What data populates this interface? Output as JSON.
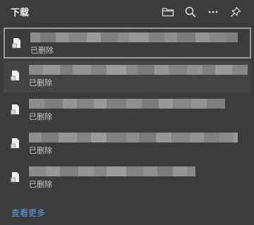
{
  "header": {
    "title": "下载",
    "icons": [
      "folder-icon",
      "search-icon",
      "more-options-icon",
      "pin-icon"
    ]
  },
  "downloads": [
    {
      "status": "已删除",
      "state": "selected"
    },
    {
      "status": "已删除",
      "state": "hover"
    },
    {
      "status": "已删除",
      "state": "normal"
    },
    {
      "status": "已删除",
      "state": "normal"
    },
    {
      "status": "已删除",
      "state": "normal"
    }
  ],
  "footer": {
    "see_more": "查看更多"
  },
  "colors": {
    "background": "#3c3c3c",
    "link": "#5aa0e6",
    "selected_border": "#9a9a9a"
  }
}
